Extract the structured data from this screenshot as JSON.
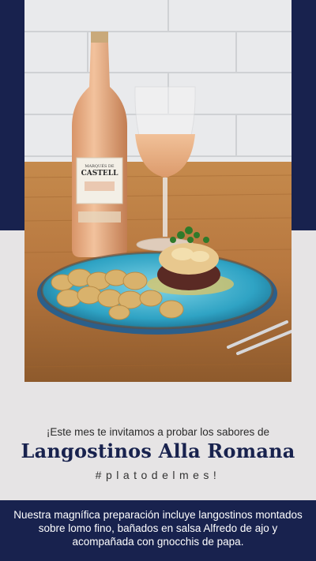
{
  "photo": {
    "subject": "rose-wine-bottle-glass-and-plated-dish",
    "bottle_label_text": "MARQUÉS DE CASTELL"
  },
  "promo": {
    "invite_text": "¡Este mes te invitamos a probar los sabores de",
    "dish_name": "Langostinos Alla Romana",
    "hashtag": "#platodelmes!",
    "description": "Nuestra magnífica preparación incluye langostinos montados sobre lomo fino, bañados en salsa Alfredo de ajo y acompañada con gnocchis de papa."
  },
  "colors": {
    "navy": "#18224e",
    "gray": "#e6e4e5",
    "plate_blue": "#2fa3c4",
    "wine_rose": "#e9a97c"
  }
}
